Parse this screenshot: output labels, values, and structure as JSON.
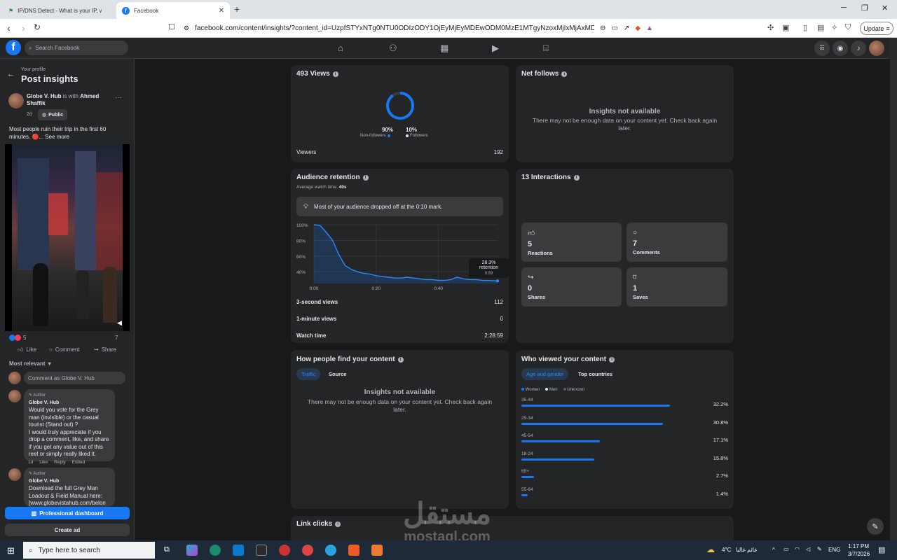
{
  "browser": {
    "tabs": [
      {
        "title": "IP/DNS Detect - What is your IP, wha"
      },
      {
        "title": "Facebook"
      }
    ],
    "url": "facebook.com/content/insights/?content_id=UzpfSTYxNTg0NTU0ODIzODY1OjEyMjEyMDEwODM0MzE1MTgyNzoxMjIxMjAxMDgzNDMxNTE4Mjc",
    "update_label": "Update"
  },
  "fb": {
    "search_placeholder": "Search Facebook"
  },
  "left": {
    "back_caption": "Your profile",
    "title": "Post insights",
    "author": "Globe V. Hub",
    "with_text": "is with",
    "tagged": "Ahmed Shaffik",
    "age": "2d",
    "privacy": "Public",
    "caption": "Most people ruin their trip in the first 60 minutes. 🔴... See more",
    "reaction_count": "5",
    "comment_count": "7",
    "actions": {
      "like": "Like",
      "comment": "Comment",
      "share": "Share"
    },
    "sort": "Most relevant",
    "comment_placeholder": "Comment as Globe V. Hub",
    "comments": [
      {
        "badge": "Author",
        "name": "Globe V. Hub",
        "text": "Would you vote for the Grey man (invisible) or the casual tourist (Stand out) ?\nI would truly appreciate if you drop a comment, like, and share if you get any value out of this reel or simply really liked it.",
        "age": "1d",
        "like": "Like",
        "reply": "Reply",
        "edited": "Edited"
      },
      {
        "badge": "Author",
        "name": "Globe V. Hub",
        "text": "Download the full Grey Man Loadout & Field Manual here: [www.globevistahub.com/belon"
      }
    ],
    "pro_dashboard": "Professional dashboard",
    "create_ad": "Create ad"
  },
  "views": {
    "title": "493 Views",
    "non_followers_pct": "90%",
    "non_followers_label": "Non-followers",
    "followers_pct": "10%",
    "followers_label": "Followers",
    "viewers_label": "Viewers",
    "viewers_value": "192",
    "donut_fraction": 0.9
  },
  "net_follows": {
    "title": "Net follows",
    "na_title": "Insights not available",
    "na_text": "There may not be enough data on your content yet. Check back again later."
  },
  "retention": {
    "title": "Audience retention",
    "avg_label": "Average watch time:",
    "avg_value": "40s",
    "tip": "Most of your audience dropped off at the 0:10 mark.",
    "tooltip_value": "28.3% retention",
    "tooltip_time": "0:59",
    "stats": [
      {
        "label": "3-second views",
        "value": "112"
      },
      {
        "label": "1-minute views",
        "value": "0"
      },
      {
        "label": "Watch time",
        "value": "2:28:59"
      }
    ]
  },
  "chart_data": {
    "type": "area",
    "x": [
      0,
      2,
      4,
      6,
      8,
      10,
      12,
      14,
      16,
      18,
      20,
      22,
      24,
      26,
      28,
      30,
      32,
      34,
      36,
      38,
      40,
      42,
      44,
      46,
      48,
      50,
      52,
      54,
      56,
      58,
      59
    ],
    "y": [
      100,
      99,
      90,
      80,
      62,
      48,
      43,
      40,
      38,
      37,
      35,
      34,
      33,
      32,
      32,
      33,
      32,
      31,
      30,
      30,
      29,
      29,
      30,
      33,
      31,
      30,
      30,
      29,
      28.8,
      28.5,
      28.3
    ],
    "xticks": [
      "0:00",
      "0:20",
      "0:40"
    ],
    "xtick_values": [
      0,
      20,
      40
    ],
    "yticks": [
      "100%",
      "80%",
      "60%",
      "40%"
    ],
    "ytick_values": [
      100,
      80,
      60,
      40
    ],
    "xlim": [
      0,
      59
    ],
    "ylim": [
      25,
      100
    ],
    "xlabel": "",
    "ylabel": "",
    "title": "",
    "grid": true
  },
  "interactions": {
    "title": "13 Interactions",
    "items": [
      {
        "value": "5",
        "label": "Reactions",
        "icon": "thumbs-up-icon"
      },
      {
        "value": "7",
        "label": "Comments",
        "icon": "comment-icon"
      },
      {
        "value": "0",
        "label": "Shares",
        "icon": "share-icon"
      },
      {
        "value": "1",
        "label": "Saves",
        "icon": "bookmark-icon"
      }
    ]
  },
  "find": {
    "title": "How people find your content",
    "tabs": [
      "Traffic",
      "Source"
    ],
    "na_title": "Insights not available",
    "na_text": "There may not be enough data on your content yet. Check back again later."
  },
  "who": {
    "title": "Who viewed your content",
    "tabs": [
      "Age and gender",
      "Top countries"
    ],
    "legend": [
      "Women",
      "Men",
      "Unknown"
    ],
    "ages": [
      {
        "label": "35-44",
        "pct": "32.2%",
        "value": 32.2
      },
      {
        "label": "25-34",
        "pct": "30.8%",
        "value": 30.8
      },
      {
        "label": "45-54",
        "pct": "17.1%",
        "value": 17.1
      },
      {
        "label": "18-24",
        "pct": "15.8%",
        "value": 15.8
      },
      {
        "label": "65+",
        "pct": "2.7%",
        "value": 2.7
      },
      {
        "label": "55-64",
        "pct": "1.4%",
        "value": 1.4
      }
    ]
  },
  "link_clicks": {
    "title": "Link clicks"
  },
  "taskbar": {
    "search_placeholder": "Type here to search",
    "temperature": "4°C",
    "weather_text": "غائم غالبا",
    "lang": "ENG",
    "time": "1:17 PM",
    "date": "3/7/2026"
  },
  "watermark": {
    "arabic": "مستقل",
    "latin": "mostaql.com"
  }
}
